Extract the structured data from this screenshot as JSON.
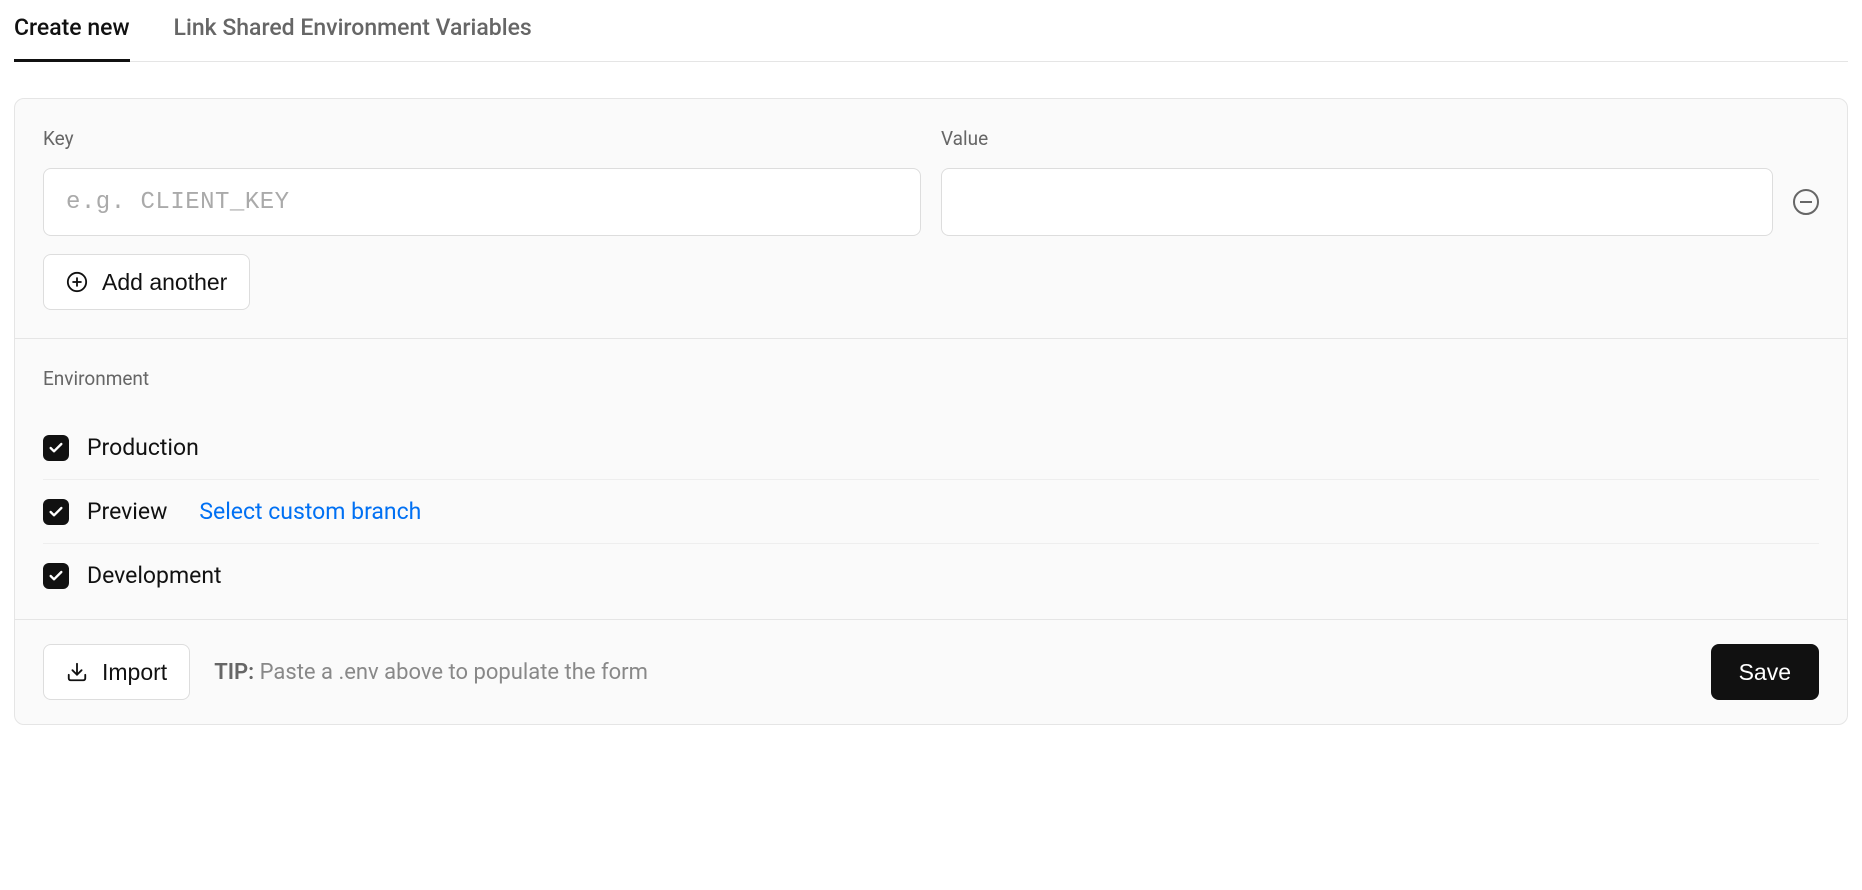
{
  "tabs": {
    "create": "Create new",
    "link": "Link Shared Environment Variables"
  },
  "fields": {
    "key_label": "Key",
    "value_label": "Value",
    "key_placeholder": "e.g. CLIENT_KEY",
    "key_value": "",
    "value_value": ""
  },
  "add_another": "Add another",
  "environment": {
    "title": "Environment",
    "items": [
      {
        "label": "Production",
        "checked": true
      },
      {
        "label": "Preview",
        "checked": true,
        "branch_link": "Select custom branch"
      },
      {
        "label": "Development",
        "checked": true
      }
    ]
  },
  "footer": {
    "import": "Import",
    "tip_label": "TIP:",
    "tip_text": " Paste a .env above to populate the form",
    "save": "Save"
  }
}
